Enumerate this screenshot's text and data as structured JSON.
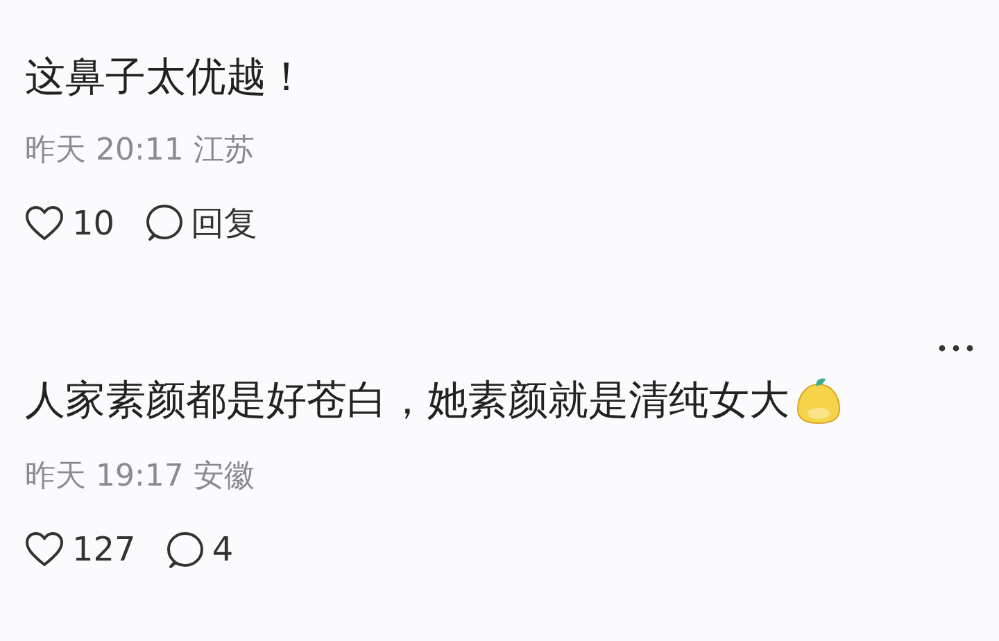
{
  "comments": [
    {
      "text": "这鼻子太优越！",
      "emoji": false,
      "meta": "昨天 20:11 江苏",
      "more_menu": false,
      "likes": "10",
      "reply": "回复"
    },
    {
      "text": "人家素颜都是好苍白，她素颜就是清纯女大",
      "emoji": true,
      "meta": "昨天 19:17 安徽",
      "more_menu": true,
      "likes": "127",
      "reply": "4"
    }
  ]
}
